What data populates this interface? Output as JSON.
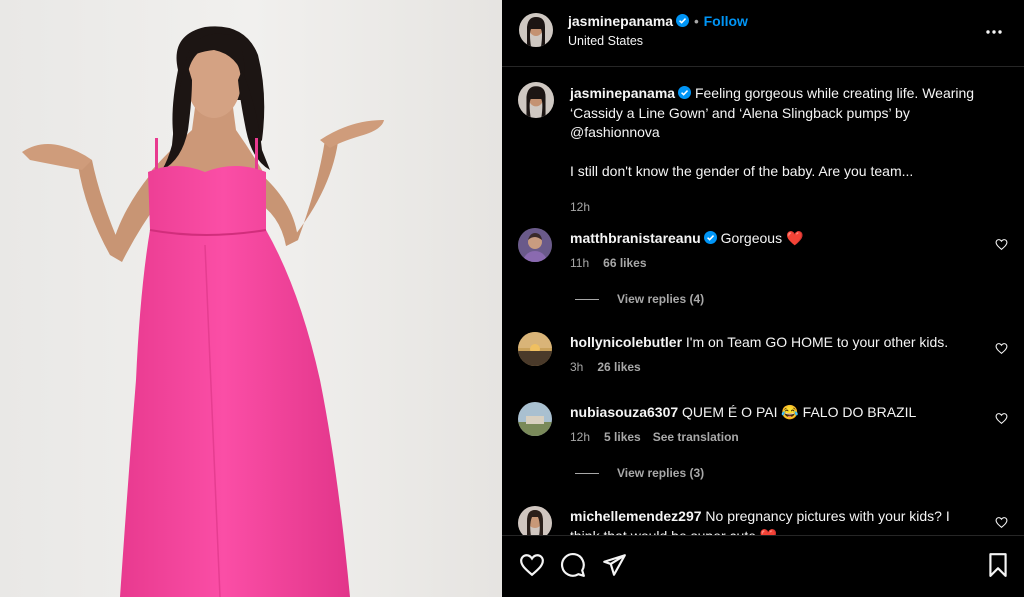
{
  "post": {
    "username": "jasminepanama",
    "follow_label": "Follow",
    "location": "United States",
    "caption_line1": "Feeling gorgeous while creating life. Wearing",
    "caption_line2": "‘Cassidy a Line Gown’ and ‘Alena Slingback pumps’ by",
    "caption_line3": "@fashionnova",
    "caption_line4": "I still don't know the gender of the baby. Are you team...",
    "time": "12h"
  },
  "comments": [
    {
      "user": "matthbranistareanu",
      "text": "Gorgeous ❤️",
      "time": "11h",
      "likes": "66 likes",
      "replies": "View replies (4)"
    },
    {
      "user": "hollynicolebutler",
      "text": "I'm on Team GO HOME to your other kids.",
      "time": "3h",
      "likes": "26 likes"
    },
    {
      "user": "nubiasouza6307",
      "text": "QUEM É O PAI 😂 FALO DO BRAZIL",
      "time": "12h",
      "likes": "5 likes",
      "translate": "See translation",
      "replies": "View replies (3)"
    },
    {
      "user": "michellemendez297",
      "text_line1": "No pregnancy pictures with your kids? I",
      "text_line2": "think that would be super cute ❤️"
    }
  ],
  "icons": {
    "more": "more-options-icon",
    "verified": "verified-badge-icon",
    "like": "heart-icon",
    "comment": "comment-icon",
    "share": "share-icon",
    "save": "bookmark-icon"
  },
  "colors": {
    "dress": "#f5419b",
    "accent": "#0095f6",
    "heart_red": "#ff3040"
  }
}
